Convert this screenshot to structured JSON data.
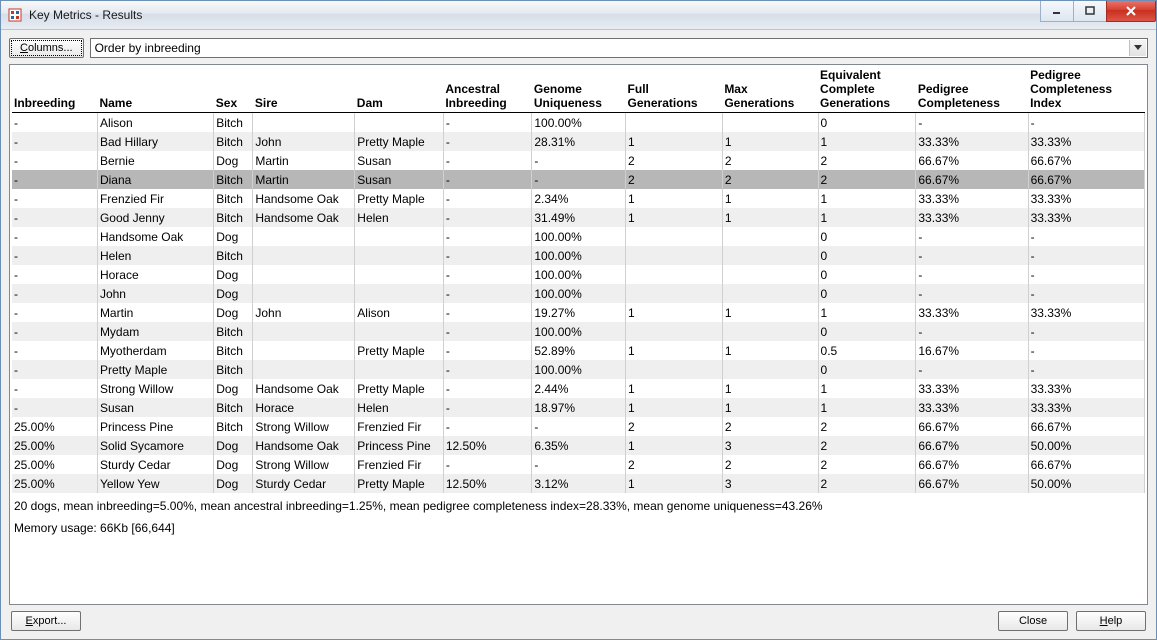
{
  "window": {
    "title": "Key Metrics - Results"
  },
  "toolbar": {
    "columns_label": "Columns...",
    "order_label": "Order by inbreeding"
  },
  "table": {
    "headers": {
      "inbreeding": "Inbreeding",
      "name": "Name",
      "sex": "Sex",
      "sire": "Sire",
      "dam": "Dam",
      "ancestral_inbreeding": "Ancestral Inbreeding",
      "genome_uniqueness": "Genome Uniqueness",
      "full_generations": "Full Generations",
      "max_generations": "Max Generations",
      "equiv_complete_generations": "Equivalent Complete Generations",
      "pedigree_completeness": "Pedigree Completeness",
      "pedigree_completeness_index": "Pedigree Completeness Index"
    },
    "rows": [
      {
        "inbreeding": "-",
        "name": "Alison",
        "sex": "Bitch",
        "sire": "",
        "dam": "",
        "ai": "-",
        "gu": "100.00%",
        "fg": "",
        "mg": "",
        "ecg": "0",
        "pc": "-",
        "pci": "-",
        "sel": false,
        "alt": false
      },
      {
        "inbreeding": "-",
        "name": "Bad Hillary",
        "sex": "Bitch",
        "sire": "John",
        "dam": "Pretty Maple",
        "ai": "-",
        "gu": "28.31%",
        "fg": "1",
        "mg": "1",
        "ecg": "1",
        "pc": "33.33%",
        "pci": "33.33%",
        "sel": false,
        "alt": true
      },
      {
        "inbreeding": "-",
        "name": "Bernie",
        "sex": "Dog",
        "sire": "Martin",
        "dam": "Susan",
        "ai": "-",
        "gu": "-",
        "fg": "2",
        "mg": "2",
        "ecg": "2",
        "pc": "66.67%",
        "pci": "66.67%",
        "sel": false,
        "alt": false
      },
      {
        "inbreeding": "-",
        "name": "Diana",
        "sex": "Bitch",
        "sire": "Martin",
        "dam": "Susan",
        "ai": "-",
        "gu": "-",
        "fg": "2",
        "mg": "2",
        "ecg": "2",
        "pc": "66.67%",
        "pci": "66.67%",
        "sel": true,
        "alt": false
      },
      {
        "inbreeding": "-",
        "name": "Frenzied Fir",
        "sex": "Bitch",
        "sire": "Handsome Oak",
        "dam": "Pretty Maple",
        "ai": "-",
        "gu": "2.34%",
        "fg": "1",
        "mg": "1",
        "ecg": "1",
        "pc": "33.33%",
        "pci": "33.33%",
        "sel": false,
        "alt": false
      },
      {
        "inbreeding": "-",
        "name": "Good Jenny",
        "sex": "Bitch",
        "sire": "Handsome Oak",
        "dam": "Helen",
        "ai": "-",
        "gu": "31.49%",
        "fg": "1",
        "mg": "1",
        "ecg": "1",
        "pc": "33.33%",
        "pci": "33.33%",
        "sel": false,
        "alt": true
      },
      {
        "inbreeding": "-",
        "name": "Handsome Oak",
        "sex": "Dog",
        "sire": "",
        "dam": "",
        "ai": "-",
        "gu": "100.00%",
        "fg": "",
        "mg": "",
        "ecg": "0",
        "pc": "-",
        "pci": "-",
        "sel": false,
        "alt": false
      },
      {
        "inbreeding": "-",
        "name": "Helen",
        "sex": "Bitch",
        "sire": "",
        "dam": "",
        "ai": "-",
        "gu": "100.00%",
        "fg": "",
        "mg": "",
        "ecg": "0",
        "pc": "-",
        "pci": "-",
        "sel": false,
        "alt": true
      },
      {
        "inbreeding": "-",
        "name": "Horace",
        "sex": "Dog",
        "sire": "",
        "dam": "",
        "ai": "-",
        "gu": "100.00%",
        "fg": "",
        "mg": "",
        "ecg": "0",
        "pc": "-",
        "pci": "-",
        "sel": false,
        "alt": false
      },
      {
        "inbreeding": "-",
        "name": "John",
        "sex": "Dog",
        "sire": "",
        "dam": "",
        "ai": "-",
        "gu": "100.00%",
        "fg": "",
        "mg": "",
        "ecg": "0",
        "pc": "-",
        "pci": "-",
        "sel": false,
        "alt": true
      },
      {
        "inbreeding": "-",
        "name": "Martin",
        "sex": "Dog",
        "sire": "John",
        "dam": "Alison",
        "ai": "-",
        "gu": "19.27%",
        "fg": "1",
        "mg": "1",
        "ecg": "1",
        "pc": "33.33%",
        "pci": "33.33%",
        "sel": false,
        "alt": false
      },
      {
        "inbreeding": "-",
        "name": "Mydam",
        "sex": "Bitch",
        "sire": "",
        "dam": "",
        "ai": "-",
        "gu": "100.00%",
        "fg": "",
        "mg": "",
        "ecg": "0",
        "pc": "-",
        "pci": "-",
        "sel": false,
        "alt": true
      },
      {
        "inbreeding": "-",
        "name": "Myotherdam",
        "sex": "Bitch",
        "sire": "",
        "dam": "Pretty Maple",
        "ai": "-",
        "gu": "52.89%",
        "fg": "1",
        "mg": "1",
        "ecg": "0.5",
        "pc": "16.67%",
        "pci": "-",
        "sel": false,
        "alt": false
      },
      {
        "inbreeding": "-",
        "name": "Pretty Maple",
        "sex": "Bitch",
        "sire": "",
        "dam": "",
        "ai": "-",
        "gu": "100.00%",
        "fg": "",
        "mg": "",
        "ecg": "0",
        "pc": "-",
        "pci": "-",
        "sel": false,
        "alt": true
      },
      {
        "inbreeding": "-",
        "name": "Strong Willow",
        "sex": "Dog",
        "sire": "Handsome Oak",
        "dam": "Pretty Maple",
        "ai": "-",
        "gu": "2.44%",
        "fg": "1",
        "mg": "1",
        "ecg": "1",
        "pc": "33.33%",
        "pci": "33.33%",
        "sel": false,
        "alt": false
      },
      {
        "inbreeding": "-",
        "name": "Susan",
        "sex": "Bitch",
        "sire": "Horace",
        "dam": "Helen",
        "ai": "-",
        "gu": "18.97%",
        "fg": "1",
        "mg": "1",
        "ecg": "1",
        "pc": "33.33%",
        "pci": "33.33%",
        "sel": false,
        "alt": true
      },
      {
        "inbreeding": "25.00%",
        "name": "Princess Pine",
        "sex": "Bitch",
        "sire": "Strong Willow",
        "dam": "Frenzied Fir",
        "ai": "-",
        "gu": "-",
        "fg": "2",
        "mg": "2",
        "ecg": "2",
        "pc": "66.67%",
        "pci": "66.67%",
        "sel": false,
        "alt": false
      },
      {
        "inbreeding": "25.00%",
        "name": "Solid Sycamore",
        "sex": "Dog",
        "sire": "Handsome Oak",
        "dam": "Princess Pine",
        "ai": "12.50%",
        "gu": "6.35%",
        "fg": "1",
        "mg": "3",
        "ecg": "2",
        "pc": "66.67%",
        "pci": "50.00%",
        "sel": false,
        "alt": true
      },
      {
        "inbreeding": "25.00%",
        "name": "Sturdy Cedar",
        "sex": "Dog",
        "sire": "Strong Willow",
        "dam": "Frenzied Fir",
        "ai": "-",
        "gu": "-",
        "fg": "2",
        "mg": "2",
        "ecg": "2",
        "pc": "66.67%",
        "pci": "66.67%",
        "sel": false,
        "alt": false
      },
      {
        "inbreeding": "25.00%",
        "name": "Yellow Yew",
        "sex": "Dog",
        "sire": "Sturdy Cedar",
        "dam": "Pretty Maple",
        "ai": "12.50%",
        "gu": "3.12%",
        "fg": "1",
        "mg": "3",
        "ecg": "2",
        "pc": "66.67%",
        "pci": "50.00%",
        "sel": false,
        "alt": true
      }
    ]
  },
  "summary": "20 dogs, mean inbreeding=5.00%, mean ancestral inbreeding=1.25%, mean pedigree completeness index=28.33%, mean genome uniqueness=43.26%",
  "memory": "Memory usage: 66Kb [66,644]",
  "footer": {
    "export_label": "Export...",
    "close_label": "Close",
    "help_label": "Help"
  },
  "col_widths": {
    "inbreeding": "83px",
    "name": "113px",
    "sex": "38px",
    "sire": "99px",
    "dam": "86px",
    "ai": "86px",
    "gu": "91px",
    "fg": "94px",
    "mg": "93px",
    "ecg": "95px",
    "pc": "109px",
    "pci": "113px"
  }
}
